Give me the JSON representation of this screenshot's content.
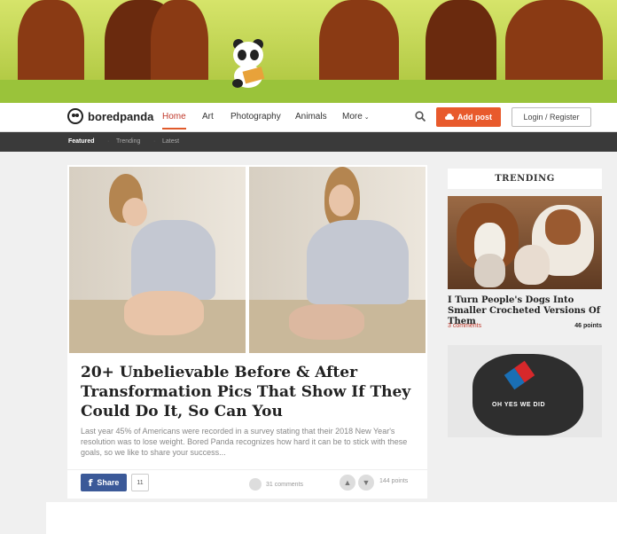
{
  "site": {
    "logo_text": "boredpanda"
  },
  "nav": {
    "items": [
      {
        "label": "Home",
        "active": true
      },
      {
        "label": "Art"
      },
      {
        "label": "Photography"
      },
      {
        "label": "Animals"
      },
      {
        "label": "More"
      }
    ],
    "add_post_label": "Add post",
    "login_label": "Login / Register",
    "accent_color": "#e85a2c"
  },
  "subnav": {
    "items": [
      "Featured",
      "Trending",
      "Latest"
    ]
  },
  "article": {
    "title": "20+ Unbelievable Before & After Transformation Pics That Show If They Could Do It, So Can You",
    "excerpt": "Last year 45% of Americans were recorded in a survey stating that their 2018 New Year's resolution was to lose weight. Bored Panda recognizes how hard it can be to stick with these goals, so we like to share your success...",
    "share_label": "Share",
    "share_count": "11",
    "comments": "31 comments",
    "points": "144 points"
  },
  "trending": {
    "heading": "TRENDING",
    "items": [
      {
        "title": "I Turn People's Dogs Into Smaller Crocheted Versions Of Them",
        "comments": "3 comments",
        "points": "46 points"
      },
      {
        "image_text": "OH YES WE DID"
      }
    ]
  }
}
